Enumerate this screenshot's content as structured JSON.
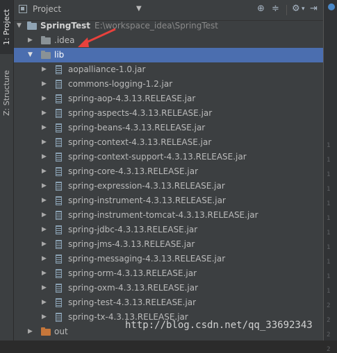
{
  "side_tabs": {
    "project": "1: Project",
    "structure": "Z: Structure"
  },
  "header": {
    "view_label": "Project",
    "icons": [
      "target-icon",
      "collapse-all-icon",
      "settings-gear-icon",
      "hide-panel-icon"
    ]
  },
  "tree": {
    "root_name": "SpringTest",
    "root_path": "E:\\workspace_idea\\SpringTest",
    "idea_folder": ".idea",
    "lib_folder": "lib",
    "jars": [
      "aopalliance-1.0.jar",
      "commons-logging-1.2.jar",
      "spring-aop-4.3.13.RELEASE.jar",
      "spring-aspects-4.3.13.RELEASE.jar",
      "spring-beans-4.3.13.RELEASE.jar",
      "spring-context-4.3.13.RELEASE.jar",
      "spring-context-support-4.3.13.RELEASE.jar",
      "spring-core-4.3.13.RELEASE.jar",
      "spring-expression-4.3.13.RELEASE.jar",
      "spring-instrument-4.3.13.RELEASE.jar",
      "spring-instrument-tomcat-4.3.13.RELEASE.jar",
      "spring-jdbc-4.3.13.RELEASE.jar",
      "spring-jms-4.3.13.RELEASE.jar",
      "spring-messaging-4.3.13.RELEASE.jar",
      "spring-orm-4.3.13.RELEASE.jar",
      "spring-oxm-4.3.13.RELEASE.jar",
      "spring-test-4.3.13.RELEASE.jar",
      "spring-tx-4.3.13.RELEASE.jar"
    ],
    "out_folder": "out"
  },
  "gutter_numbers": [
    "1",
    "1",
    "1",
    "1",
    "1",
    "1",
    "1",
    "1",
    "1",
    "1",
    "1",
    "2",
    "2",
    "2",
    "2"
  ],
  "watermark": "http://blog.csdn.net/qq_33692343",
  "colors": {
    "selection": "#4b6eaf",
    "panel_bg": "#3c3f41",
    "editor_bg": "#2b2b2b",
    "annotation_arrow": "#e8413c"
  }
}
